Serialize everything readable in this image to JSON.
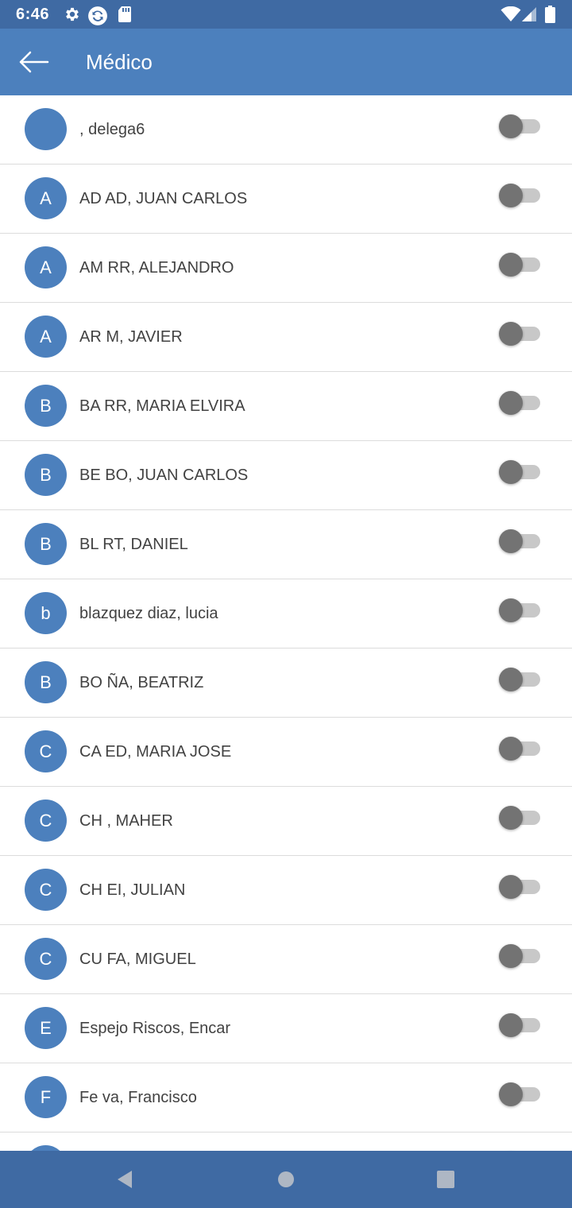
{
  "status_bar": {
    "time": "6:46"
  },
  "app_bar": {
    "title": "Médico"
  },
  "list": {
    "items": [
      {
        "initial": "",
        "name": ", delega6",
        "enabled": false
      },
      {
        "initial": "A",
        "name": "AD AD, JUAN CARLOS",
        "enabled": false
      },
      {
        "initial": "A",
        "name": "AM RR, ALEJANDRO",
        "enabled": false
      },
      {
        "initial": "A",
        "name": "AR M, JAVIER",
        "enabled": false
      },
      {
        "initial": "B",
        "name": "BA RR, MARIA ELVIRA",
        "enabled": false
      },
      {
        "initial": "B",
        "name": "BE BO, JUAN CARLOS",
        "enabled": false
      },
      {
        "initial": "B",
        "name": "BL RT, DANIEL",
        "enabled": false
      },
      {
        "initial": "b",
        "name": "blazquez diaz, lucia",
        "enabled": false
      },
      {
        "initial": "B",
        "name": "BO ÑA, BEATRIZ",
        "enabled": false
      },
      {
        "initial": "C",
        "name": "CA ED, MARIA JOSE",
        "enabled": false
      },
      {
        "initial": "C",
        "name": "CH , MAHER",
        "enabled": false
      },
      {
        "initial": "C",
        "name": "CH EI, JULIAN",
        "enabled": false
      },
      {
        "initial": "C",
        "name": "CU FA, MIGUEL",
        "enabled": false
      },
      {
        "initial": "E",
        "name": "Espejo Riscos, Encar",
        "enabled": false
      },
      {
        "initial": "F",
        "name": "Fe va, Francisco",
        "enabled": false
      },
      {
        "initial": "",
        "name": "",
        "enabled": false
      }
    ]
  },
  "colors": {
    "status_bar": "#3f6aa3",
    "app_bar": "#4c80bd",
    "avatar": "#4c80bd",
    "toggle_thumb": "#737373",
    "toggle_track": "#c8c8c8"
  },
  "icons": {
    "back": "arrow-left-icon",
    "settings": "gear-icon",
    "sync": "sync-icon",
    "sd_card": "sd-card-icon",
    "wifi": "wifi-icon",
    "signal": "signal-icon",
    "battery": "battery-icon",
    "nav_back": "triangle-back-icon",
    "nav_home": "circle-home-icon",
    "nav_recent": "square-recent-icon"
  }
}
